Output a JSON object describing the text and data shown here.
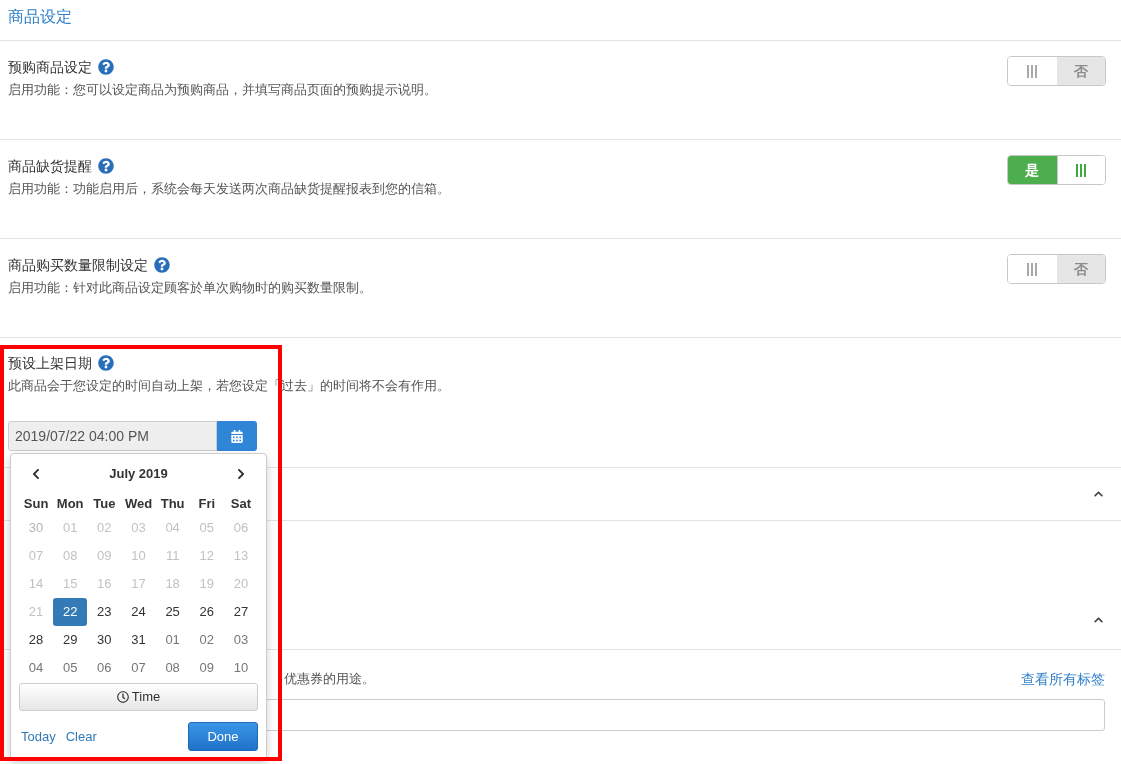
{
  "page_title": "商品设定",
  "settings": [
    {
      "title": "预购商品设定",
      "description": "启用功能：您可以设定商品为预购商品，并填写商品页面的预购提示说明。",
      "switch": {
        "on": false,
        "label": "否"
      }
    },
    {
      "title": "商品缺货提醒",
      "description": "启用功能：功能启用后，系统会每天发送两次商品缺货提醒报表到您的信箱。",
      "switch": {
        "on": true,
        "label": "是"
      }
    },
    {
      "title": "商品购买数量限制设定",
      "description": "启用功能：针对此商品设定顾客於单次购物时的购买数量限制。",
      "switch": {
        "on": false,
        "label": "否"
      }
    }
  ],
  "publish_date": {
    "title": "预设上架日期",
    "description": "此商品会于您设定的时间自动上架，若您设定「过去」的时间将不会有作用。",
    "value": "2019/07/22 04:00 PM",
    "datepicker": {
      "month": "July 2019",
      "weekdays": [
        "Sun",
        "Mon",
        "Tue",
        "Wed",
        "Thu",
        "Fri",
        "Sat"
      ],
      "weeks": [
        [
          {
            "day": "30",
            "disabled": true,
            "adjacent_month": true,
            "selected": false
          },
          {
            "day": "01",
            "disabled": true,
            "adjacent_month": false,
            "selected": false
          },
          {
            "day": "02",
            "disabled": true,
            "adjacent_month": false,
            "selected": false
          },
          {
            "day": "03",
            "disabled": true,
            "adjacent_month": false,
            "selected": false
          },
          {
            "day": "04",
            "disabled": true,
            "adjacent_month": false,
            "selected": false
          },
          {
            "day": "05",
            "disabled": true,
            "adjacent_month": false,
            "selected": false
          },
          {
            "day": "06",
            "disabled": true,
            "adjacent_month": false,
            "selected": false
          }
        ],
        [
          {
            "day": "07",
            "disabled": true,
            "adjacent_month": false,
            "selected": false
          },
          {
            "day": "08",
            "disabled": true,
            "adjacent_month": false,
            "selected": false
          },
          {
            "day": "09",
            "disabled": true,
            "adjacent_month": false,
            "selected": false
          },
          {
            "day": "10",
            "disabled": true,
            "adjacent_month": false,
            "selected": false
          },
          {
            "day": "11",
            "disabled": true,
            "adjacent_month": false,
            "selected": false
          },
          {
            "day": "12",
            "disabled": true,
            "adjacent_month": false,
            "selected": false
          },
          {
            "day": "13",
            "disabled": true,
            "adjacent_month": false,
            "selected": false
          }
        ],
        [
          {
            "day": "14",
            "disabled": true,
            "adjacent_month": false,
            "selected": false
          },
          {
            "day": "15",
            "disabled": true,
            "adjacent_month": false,
            "selected": false
          },
          {
            "day": "16",
            "disabled": true,
            "adjacent_month": false,
            "selected": false
          },
          {
            "day": "17",
            "disabled": true,
            "adjacent_month": false,
            "selected": false
          },
          {
            "day": "18",
            "disabled": true,
            "adjacent_month": false,
            "selected": false
          },
          {
            "day": "19",
            "disabled": true,
            "adjacent_month": false,
            "selected": false
          },
          {
            "day": "20",
            "disabled": true,
            "adjacent_month": false,
            "selected": false
          }
        ],
        [
          {
            "day": "21",
            "disabled": true,
            "adjacent_month": false,
            "selected": false
          },
          {
            "day": "22",
            "disabled": false,
            "adjacent_month": false,
            "selected": true
          },
          {
            "day": "23",
            "disabled": false,
            "adjacent_month": false,
            "selected": false
          },
          {
            "day": "24",
            "disabled": false,
            "adjacent_month": false,
            "selected": false
          },
          {
            "day": "25",
            "disabled": false,
            "adjacent_month": false,
            "selected": false
          },
          {
            "day": "26",
            "disabled": false,
            "adjacent_month": false,
            "selected": false
          },
          {
            "day": "27",
            "disabled": false,
            "adjacent_month": false,
            "selected": false
          }
        ],
        [
          {
            "day": "28",
            "disabled": false,
            "adjacent_month": false,
            "selected": false
          },
          {
            "day": "29",
            "disabled": false,
            "adjacent_month": false,
            "selected": false
          },
          {
            "day": "30",
            "disabled": false,
            "adjacent_month": false,
            "selected": false
          },
          {
            "day": "31",
            "disabled": false,
            "adjacent_month": false,
            "selected": false
          },
          {
            "day": "01",
            "disabled": false,
            "adjacent_month": true,
            "selected": false
          },
          {
            "day": "02",
            "disabled": false,
            "adjacent_month": true,
            "selected": false
          },
          {
            "day": "03",
            "disabled": false,
            "adjacent_month": true,
            "selected": false
          }
        ],
        [
          {
            "day": "04",
            "disabled": false,
            "adjacent_month": true,
            "selected": false
          },
          {
            "day": "05",
            "disabled": false,
            "adjacent_month": true,
            "selected": false
          },
          {
            "day": "06",
            "disabled": false,
            "adjacent_month": true,
            "selected": false
          },
          {
            "day": "07",
            "disabled": false,
            "adjacent_month": true,
            "selected": false
          },
          {
            "day": "08",
            "disabled": false,
            "adjacent_month": true,
            "selected": false
          },
          {
            "day": "09",
            "disabled": false,
            "adjacent_month": true,
            "selected": false
          },
          {
            "day": "10",
            "disabled": false,
            "adjacent_month": true,
            "selected": false
          }
        ]
      ],
      "time_button": "Time",
      "links": [
        "Today",
        "Clear"
      ],
      "done_button": "Done"
    }
  },
  "collapsible_headers": [
    {
      "expanded": true
    },
    {
      "expanded": true
    }
  ],
  "tag_section": {
    "hint": "优惠券的用途。",
    "link": "查看所有标签"
  }
}
